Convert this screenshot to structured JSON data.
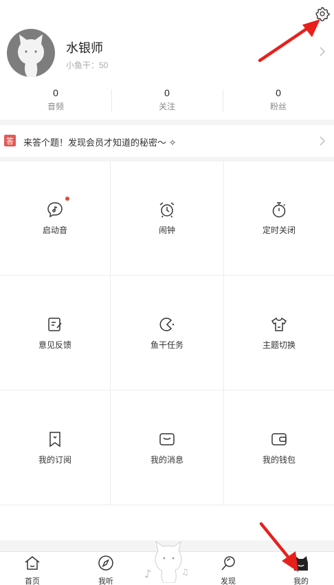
{
  "profile": {
    "username": "水银师",
    "fish_label": "小鱼干：50"
  },
  "stats": [
    {
      "value": "0",
      "label": "音频"
    },
    {
      "value": "0",
      "label": "关注"
    },
    {
      "value": "0",
      "label": "粉丝"
    }
  ],
  "banner": {
    "badge": "答",
    "text": "来答个题！发现会员才知道的秘密～ ✧"
  },
  "grid": [
    {
      "label": "启动音",
      "icon": "music-bubble-icon",
      "has_dot": true
    },
    {
      "label": "闹钟",
      "icon": "alarm-clock-icon"
    },
    {
      "label": "定时关闭",
      "icon": "timer-icon"
    },
    {
      "label": "意见反馈",
      "icon": "feedback-icon"
    },
    {
      "label": "鱼干任务",
      "icon": "fish-task-icon"
    },
    {
      "label": "主题切换",
      "icon": "tshirt-icon"
    },
    {
      "label": "我的订阅",
      "icon": "subscription-icon"
    },
    {
      "label": "我的消息",
      "icon": "message-icon"
    },
    {
      "label": "我的钱包",
      "icon": "wallet-icon"
    }
  ],
  "tabs": [
    {
      "label": "首页",
      "icon": "home-icon"
    },
    {
      "label": "我听",
      "icon": "compass-icon"
    },
    {
      "label": "发现",
      "icon": "discover-icon"
    },
    {
      "label": "我的",
      "icon": "cat-profile-icon",
      "active": true
    }
  ],
  "colors": {
    "accent_red": "#e15a55",
    "annotation_arrow": "#e8201c"
  }
}
